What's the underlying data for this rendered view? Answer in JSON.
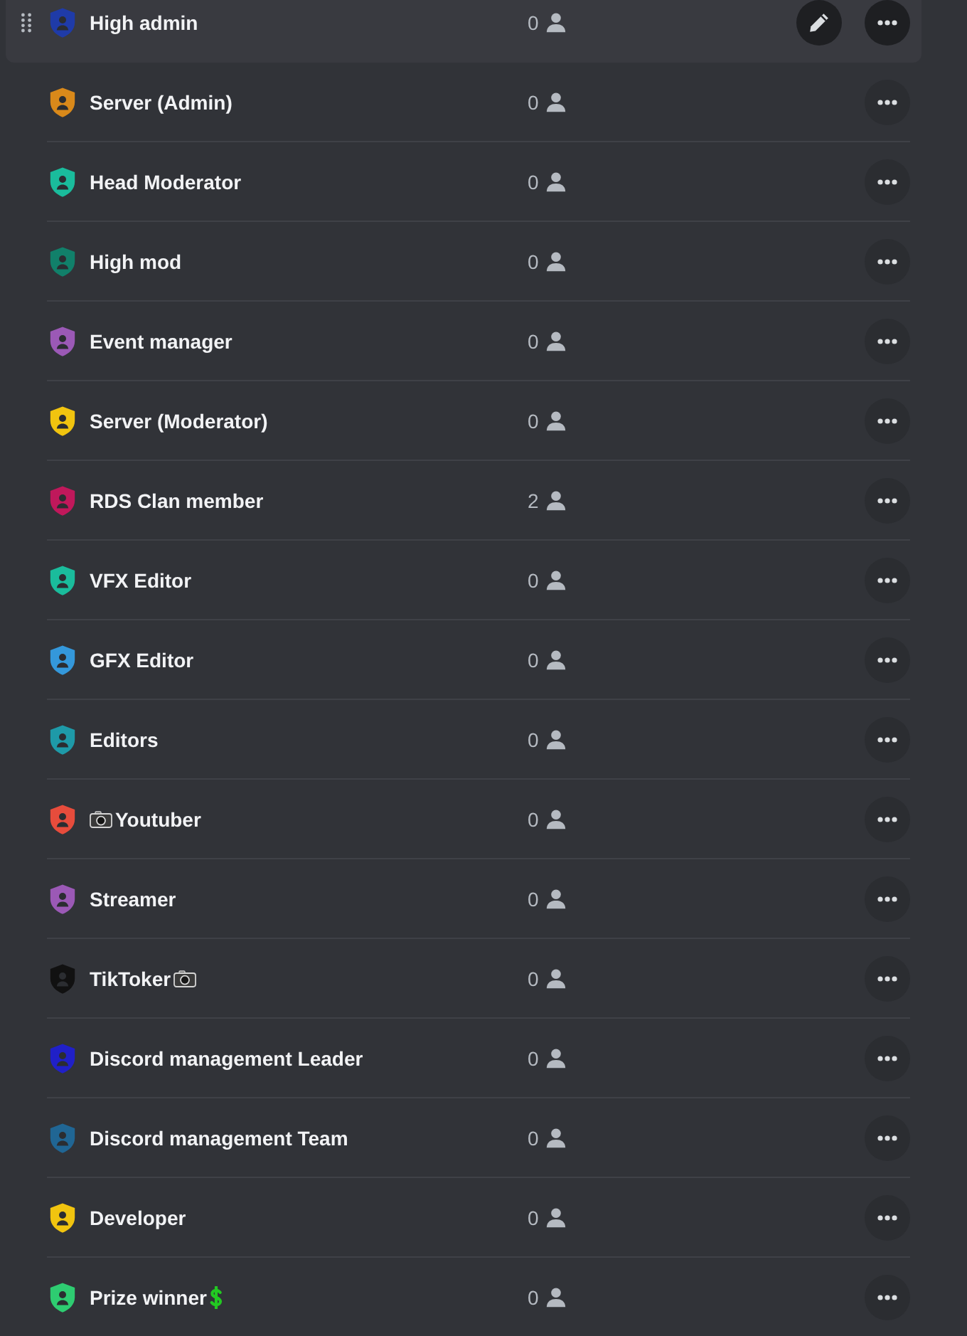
{
  "roles": [
    {
      "name": "High admin",
      "color": "#1f3ba8",
      "member_count": "0",
      "hovered": true
    },
    {
      "name": "Server (Admin)",
      "color": "#d9891a",
      "member_count": "0",
      "hovered": false
    },
    {
      "name": "Head Moderator",
      "color": "#1abc9c",
      "member_count": "0",
      "hovered": false
    },
    {
      "name": "High mod",
      "color": "#11806a",
      "member_count": "0",
      "hovered": false
    },
    {
      "name": "Event manager",
      "color": "#9b59b6",
      "member_count": "0",
      "hovered": false
    },
    {
      "name": "Server (Moderator)",
      "color": "#f1c40f",
      "member_count": "0",
      "hovered": false
    },
    {
      "name": "RDS Clan member",
      "color": "#c0185b",
      "member_count": "2",
      "hovered": false
    },
    {
      "name": "VFX Editor",
      "color": "#1abc9c",
      "member_count": "0",
      "hovered": false
    },
    {
      "name": "GFX Editor",
      "color": "#3498db",
      "member_count": "0",
      "hovered": false
    },
    {
      "name": "Editors",
      "color": "#1e9aa8",
      "member_count": "0",
      "hovered": false
    },
    {
      "name": "Youtuber",
      "emoji_before": {
        "kind": "camera"
      },
      "color": "#e74c3c",
      "member_count": "0",
      "hovered": false
    },
    {
      "name": "Streamer",
      "color": "#9b59b6",
      "member_count": "0",
      "hovered": false
    },
    {
      "name": "TikToker",
      "emoji_after": {
        "kind": "camera"
      },
      "color": "#111111",
      "member_count": "0",
      "hovered": false
    },
    {
      "name": "Discord management Leader",
      "color": "#2020c8",
      "member_count": "0",
      "hovered": false
    },
    {
      "name": "Discord management Team",
      "color": "#206694",
      "member_count": "0",
      "hovered": false
    },
    {
      "name": "Developer",
      "color": "#f1c40f",
      "member_count": "0",
      "hovered": false
    },
    {
      "name": "Prize winner",
      "emoji_after": {
        "kind": "dollar"
      },
      "color": "#2ecc71",
      "member_count": "0",
      "hovered": false
    }
  ]
}
